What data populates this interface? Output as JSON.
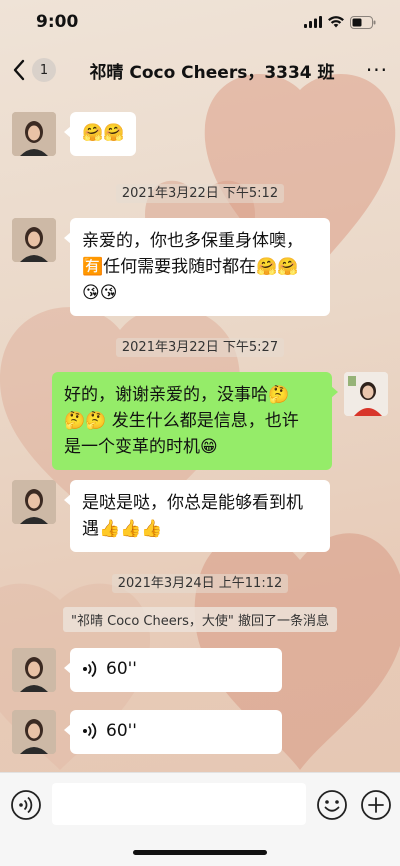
{
  "status_bar": {
    "time": "9:00"
  },
  "nav": {
    "badge": "1",
    "title": "祁晴 Coco Cheers，3334 班",
    "more": "···"
  },
  "messages": {
    "m1": {
      "emoji": "🤗🤗"
    },
    "t1": "2021年3月22日 下午5:12",
    "m2": {
      "line1": "亲爱的，你也多保重身体噢，",
      "line2": "🈶任何需要我随时都在🤗🤗",
      "line3": "😘😘"
    },
    "t2": "2021年3月22日 下午5:27",
    "m3": {
      "line1": "好的，谢谢亲爱的，没事哈🤔",
      "line2": "🤔🤔 发生什么都是信息，也许",
      "line3": "是一个变革的时机😁"
    },
    "m4": {
      "line1": "是哒是哒，你总是能够看到机",
      "line2": "遇👍👍👍"
    },
    "t3": "2021年3月24日 上午11:12",
    "recall": "\"祁晴 Coco Cheers，大使\" 撤回了一条消息",
    "v1": {
      "duration": "60''"
    },
    "v2": {
      "duration": "60''"
    }
  },
  "input_bar": {
    "voice_icon": "voice-icon",
    "emoji_icon": "emoji-icon",
    "plus_icon": "plus-icon"
  },
  "colors": {
    "my_bubble": "#95ec69",
    "other_bubble": "#ffffff",
    "input_bg": "#f6f6f6"
  }
}
